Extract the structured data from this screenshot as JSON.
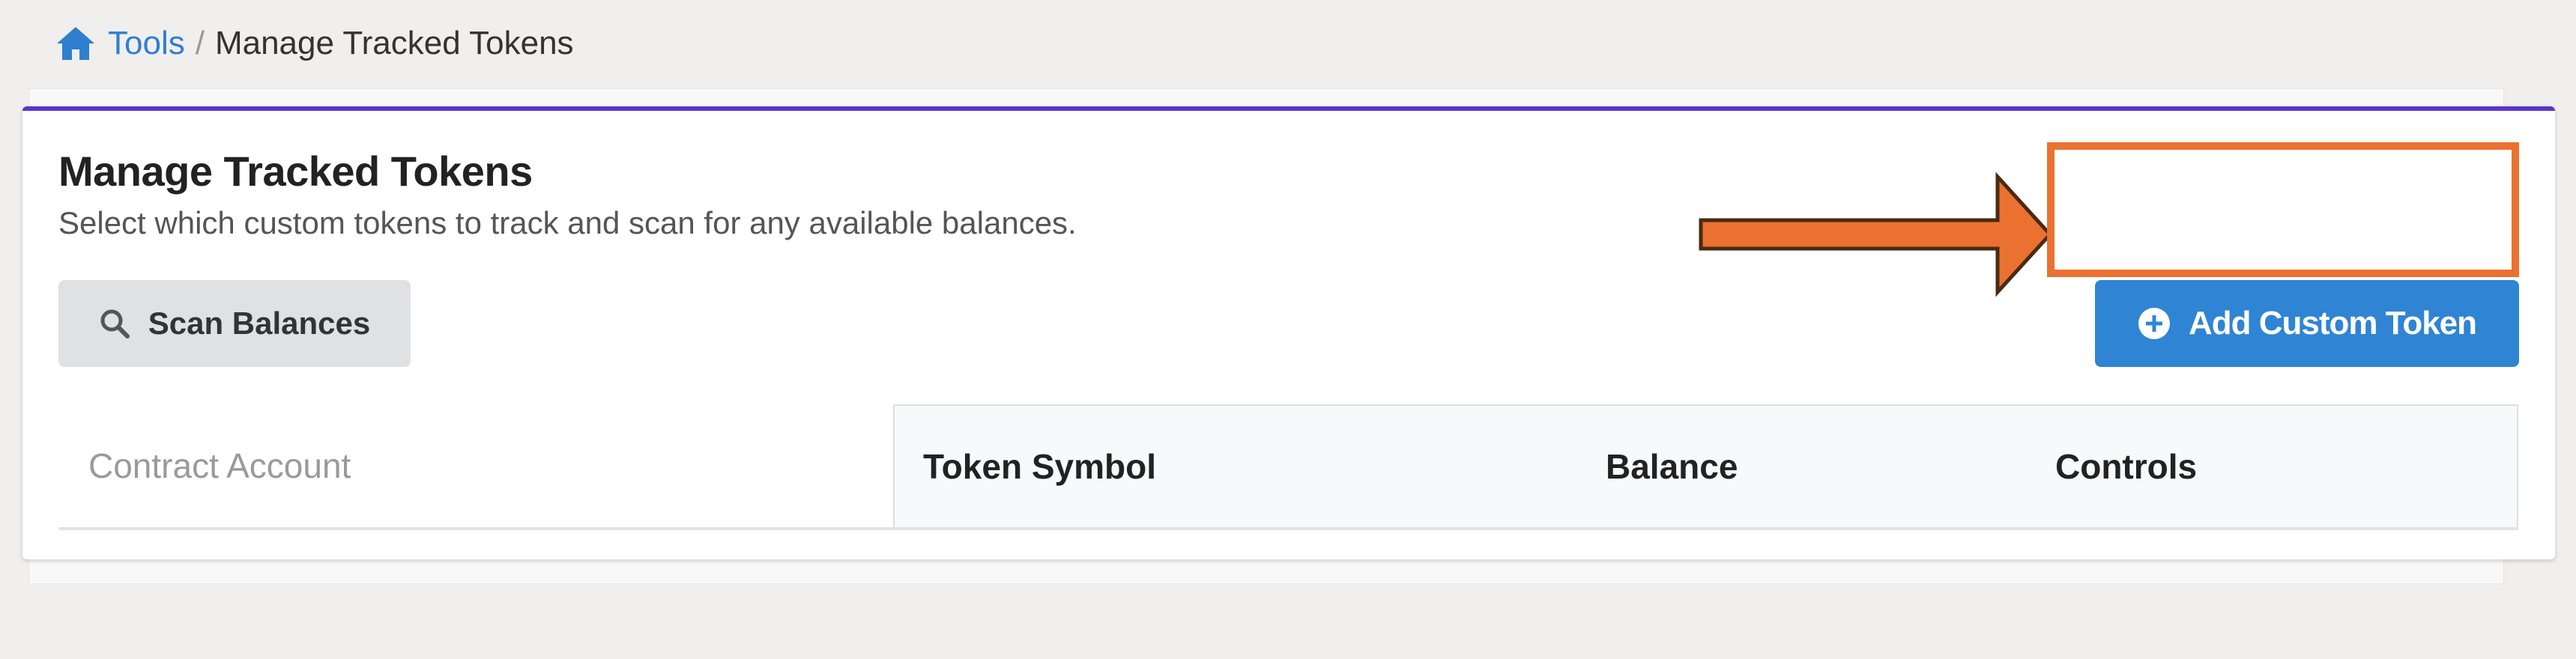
{
  "breadcrumb": {
    "home_label": "Tools",
    "separator": "/",
    "current": "Manage Tracked Tokens"
  },
  "panel": {
    "title": "Manage Tracked Tokens",
    "subtitle": "Select which custom tokens to track and scan for any available balances."
  },
  "actions": {
    "scan_label": "Scan Balances",
    "add_label": "Add Custom Token"
  },
  "table": {
    "columns": [
      "Contract Account",
      "Token Symbol",
      "Balance",
      "Controls"
    ]
  },
  "colors": {
    "accent_top_border": "#5b34c9",
    "primary_button": "#2f84d4",
    "secondary_button": "#e0e1e2",
    "annotation_orange": "#ea7130",
    "link": "#2f7fd1"
  },
  "icons": {
    "home": "home-icon",
    "search": "search-icon",
    "add": "plus-circle-icon"
  }
}
